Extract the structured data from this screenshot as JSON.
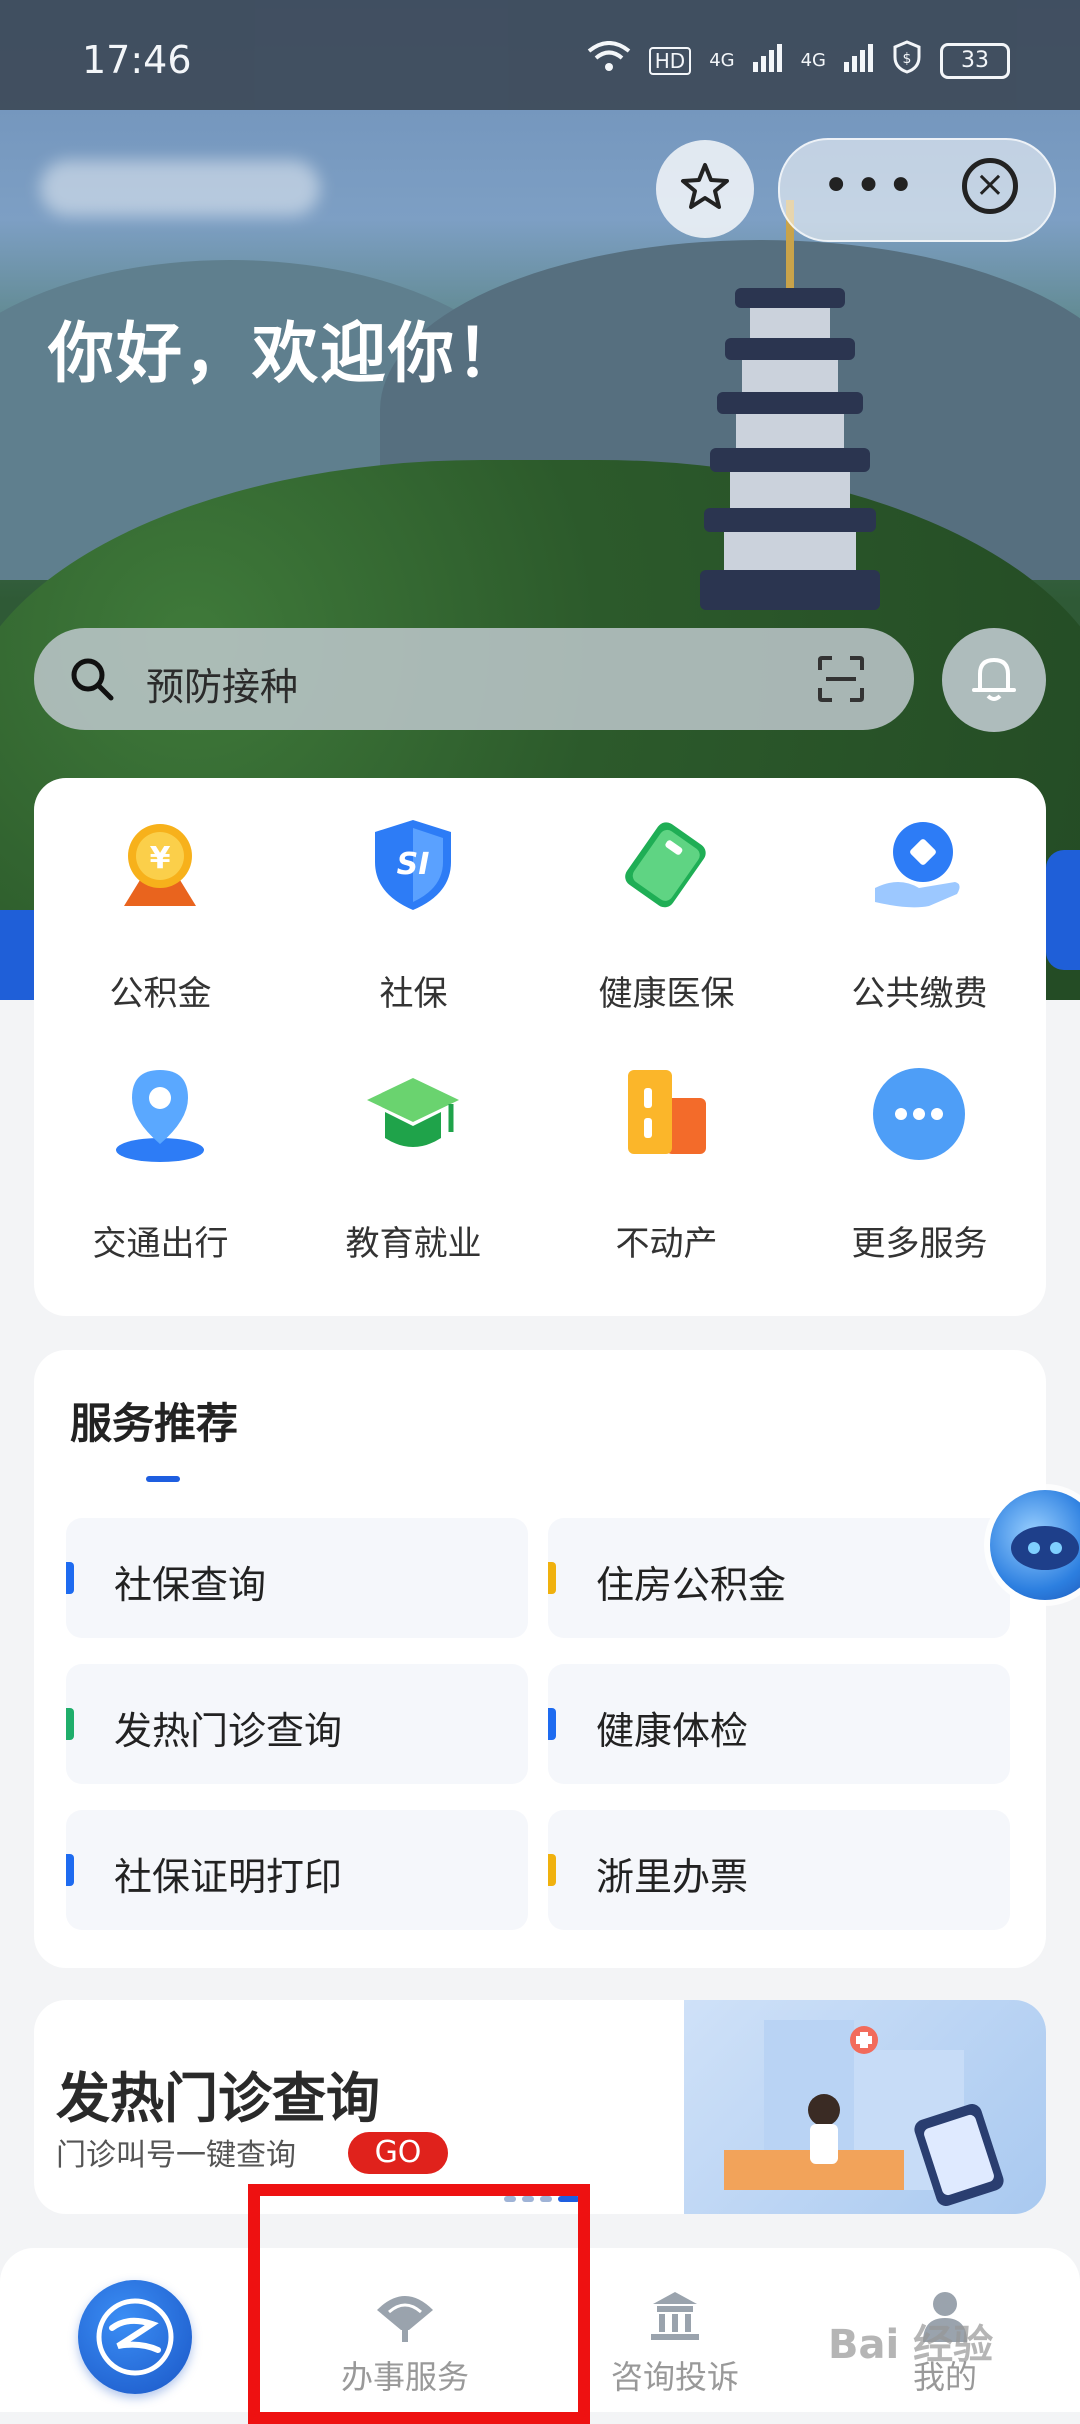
{
  "status_bar": {
    "time": "17:46",
    "battery": "33",
    "network_labels": [
      "HD",
      "4G",
      "4G"
    ]
  },
  "header": {
    "greeting": "你好，欢迎你！",
    "favorite_icon": "star-icon",
    "more_icon": "more-dots-icon",
    "close_icon": "close-circle-icon"
  },
  "search": {
    "placeholder": "预防接种",
    "scan_icon": "scan-icon",
    "bell_icon": "bell-icon"
  },
  "services": {
    "items": [
      {
        "label": "公积金",
        "icon": "housing-fund-coin-icon",
        "color": "#f39c12"
      },
      {
        "label": "社保",
        "icon": "social-security-shield-icon",
        "color": "#2d7cf6"
      },
      {
        "label": "健康医保",
        "icon": "health-insurance-card-icon",
        "color": "#27ae60"
      },
      {
        "label": "公共缴费",
        "icon": "public-payment-icon",
        "color": "#2d7cf6"
      },
      {
        "label": "交通出行",
        "icon": "location-pin-icon",
        "color": "#2d7cf6"
      },
      {
        "label": "教育就业",
        "icon": "graduation-cap-icon",
        "color": "#27ae60"
      },
      {
        "label": "不动产",
        "icon": "real-estate-icon",
        "color": "#f39c12"
      },
      {
        "label": "更多服务",
        "icon": "more-services-icon",
        "color": "#2d7cf6"
      }
    ]
  },
  "recommend": {
    "title": "服务推荐",
    "items": [
      {
        "label": "社保查询",
        "color": "#1e6bf0"
      },
      {
        "label": "住房公积金",
        "color": "#f0b10e"
      },
      {
        "label": "发热门诊查询",
        "color": "#1fae6b"
      },
      {
        "label": "健康体检",
        "color": "#1e6bf0"
      },
      {
        "label": "社保证明打印",
        "color": "#1e6bf0"
      },
      {
        "label": "浙里办票",
        "color": "#f0b10e"
      }
    ]
  },
  "banner": {
    "title": "发热门诊查询",
    "subtitle": "门诊叫号一键查询",
    "cta": "GO"
  },
  "tabbar": {
    "items": [
      {
        "label": "",
        "icon": "home-logo-icon"
      },
      {
        "label": "办事服务",
        "icon": "fan-icon"
      },
      {
        "label": "咨询投诉",
        "icon": "building-icon"
      },
      {
        "label": "我的",
        "icon": "user-icon"
      }
    ]
  },
  "watermark": "Bai 经验"
}
